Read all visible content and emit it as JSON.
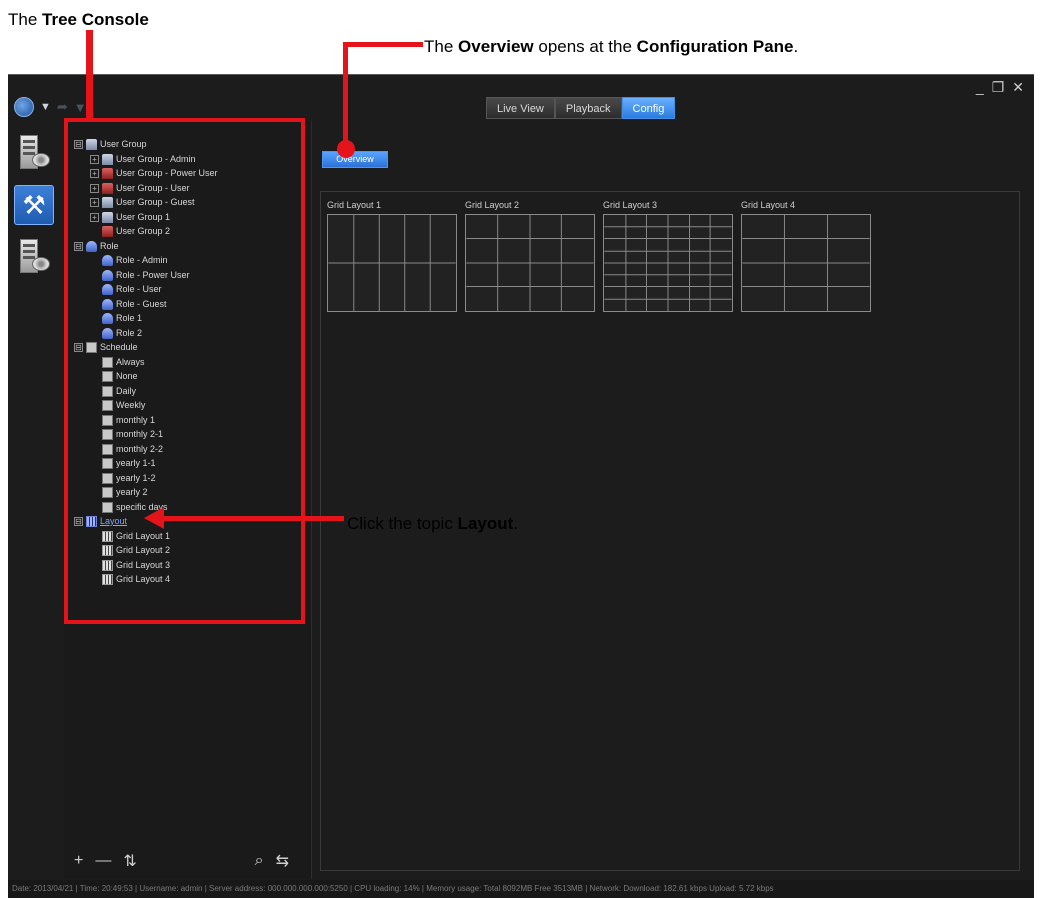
{
  "annotations": {
    "tree_prefix": "The ",
    "tree_bold": "Tree Console",
    "overview_prefix": "The ",
    "overview_bold1": "Overview",
    "overview_mid": " opens at the ",
    "overview_bold2": "Configuration Pane",
    "overview_suffix": ".",
    "layout_prefix": "Click the topic ",
    "layout_bold": "Layout",
    "layout_suffix": "."
  },
  "window": {
    "minimize": "_",
    "restore": "❐",
    "close": "✕"
  },
  "tabs": [
    {
      "label": "Live View",
      "active": false
    },
    {
      "label": "Playback",
      "active": false
    },
    {
      "label": "Config",
      "active": true
    }
  ],
  "overview_button": "Overview",
  "tree": {
    "user_group": "User Group",
    "user_group_admin": "User Group - Admin",
    "user_group_power": "User Group - Power User",
    "user_group_user": "User Group - User",
    "user_group_guest": "User Group - Guest",
    "user_group_1": "User Group 1",
    "user_group_2": "User Group 2",
    "role": "Role",
    "role_admin": "Role - Admin",
    "role_power": "Role - Power User",
    "role_user": "Role - User",
    "role_guest": "Role - Guest",
    "role_1": "Role 1",
    "role_2": "Role 2",
    "schedule": "Schedule",
    "sched_always": "Always",
    "sched_none": "None",
    "sched_daily": "Daily",
    "sched_weekly": "Weekly",
    "sched_monthly1": "monthly 1",
    "sched_monthly21": "monthly 2-1",
    "sched_monthly22": "monthly 2-2",
    "sched_yearly11": "yearly 1-1",
    "sched_yearly12": "yearly 1-2",
    "sched_yearly2": "yearly 2",
    "sched_specific": "specific days",
    "layout": "Layout",
    "layout_g1": "Grid Layout 1",
    "layout_g2": "Grid Layout 2",
    "layout_g3": "Grid Layout 3",
    "layout_g4": "Grid Layout 4",
    "expand_glyph": "⊟"
  },
  "tree_toolbar": {
    "add": "+",
    "remove": "—",
    "sort": "⇅",
    "search": "⌕",
    "refresh": "⇆"
  },
  "layouts": [
    {
      "title": "Grid Layout 1"
    },
    {
      "title": "Grid Layout 2"
    },
    {
      "title": "Grid Layout 3"
    },
    {
      "title": "Grid Layout 4"
    }
  ],
  "statusbar": "Date: 2013/04/21 | Time: 20:49:53 | Username: admin | Server address: 000.000.000.000:5250 | CPU loading: 14% | Memory usage: Total 8092MB  Free 3513MB | Network: Download: 182.61 kbps Upload: 5.72 kbps"
}
